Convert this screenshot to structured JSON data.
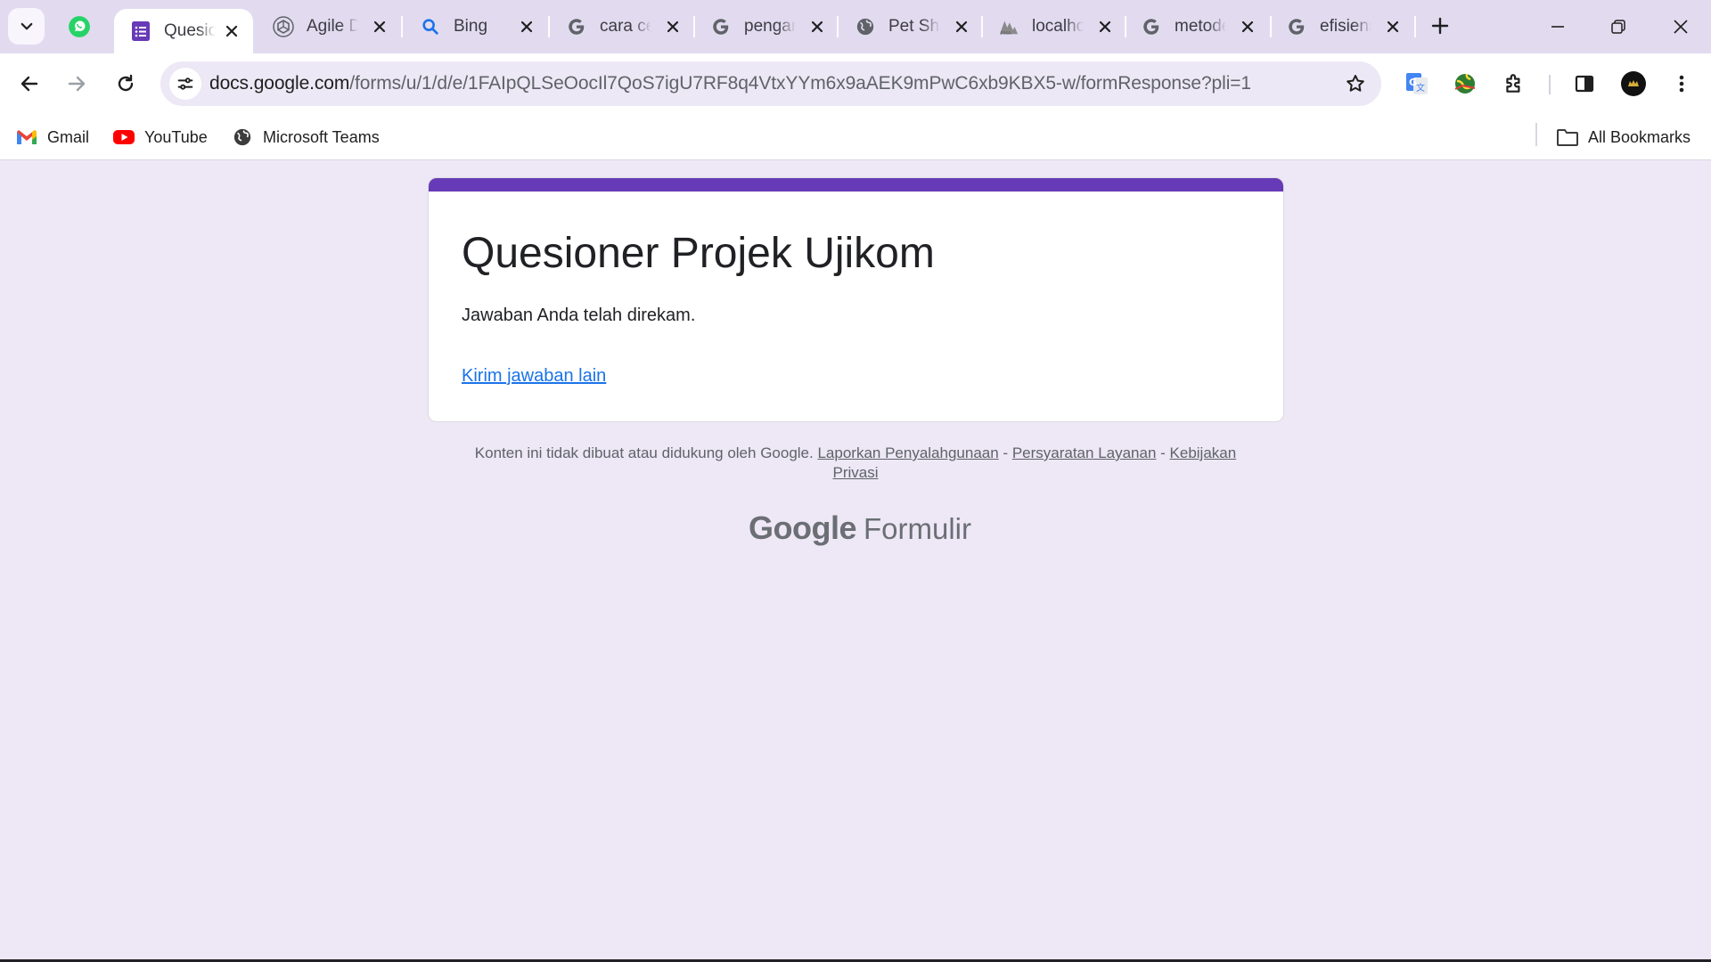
{
  "browser": {
    "tabs": [
      {
        "title": "Quesioner Projek Ujikom",
        "favicon": "google-forms-icon",
        "active": true
      },
      {
        "title": "Agile Development",
        "favicon": "chatgpt-icon",
        "active": false
      },
      {
        "title": "Bing",
        "favicon": "bing-search-icon",
        "active": false
      },
      {
        "title": "cara cepat",
        "favicon": "google-icon",
        "active": false
      },
      {
        "title": "pengaruh",
        "favicon": "google-icon",
        "active": false
      },
      {
        "title": "Pet Shop",
        "favicon": "globe-icon",
        "active": false
      },
      {
        "title": "localhost",
        "favicon": "phpmyadmin-icon",
        "active": false
      },
      {
        "title": "metode",
        "favicon": "google-icon",
        "active": false
      },
      {
        "title": "efisiensi",
        "favicon": "google-icon",
        "active": false
      }
    ],
    "url_host": "docs.google.com",
    "url_path": "/forms/u/1/d/e/1FAIpQLSeOocIl7QoS7igU7RF8q4VtxYYm6x9aAEK9mPwC6xb9KBX5-w/formResponse?pli=1",
    "bookmarks": [
      {
        "label": "Gmail",
        "icon": "gmail-icon"
      },
      {
        "label": "YouTube",
        "icon": "youtube-icon"
      },
      {
        "label": "Microsoft Teams",
        "icon": "globe-icon"
      }
    ],
    "all_bookmarks_label": "All Bookmarks"
  },
  "form": {
    "title": "Quesioner Projek Ujikom",
    "confirmation": "Jawaban Anda telah direkam.",
    "another_response_link": "Kirim jawaban lain",
    "accent_color": "#673ab7"
  },
  "footer": {
    "disclaimer": "Konten ini tidak dibuat atau didukung oleh Google.",
    "report_abuse": "Laporkan Penyalahgunaan",
    "sep1": " - ",
    "terms": "Persyaratan Layanan",
    "sep2": " - ",
    "privacy": "Kebijakan Privasi",
    "brand_google": "Google",
    "brand_product": "Formulir"
  }
}
